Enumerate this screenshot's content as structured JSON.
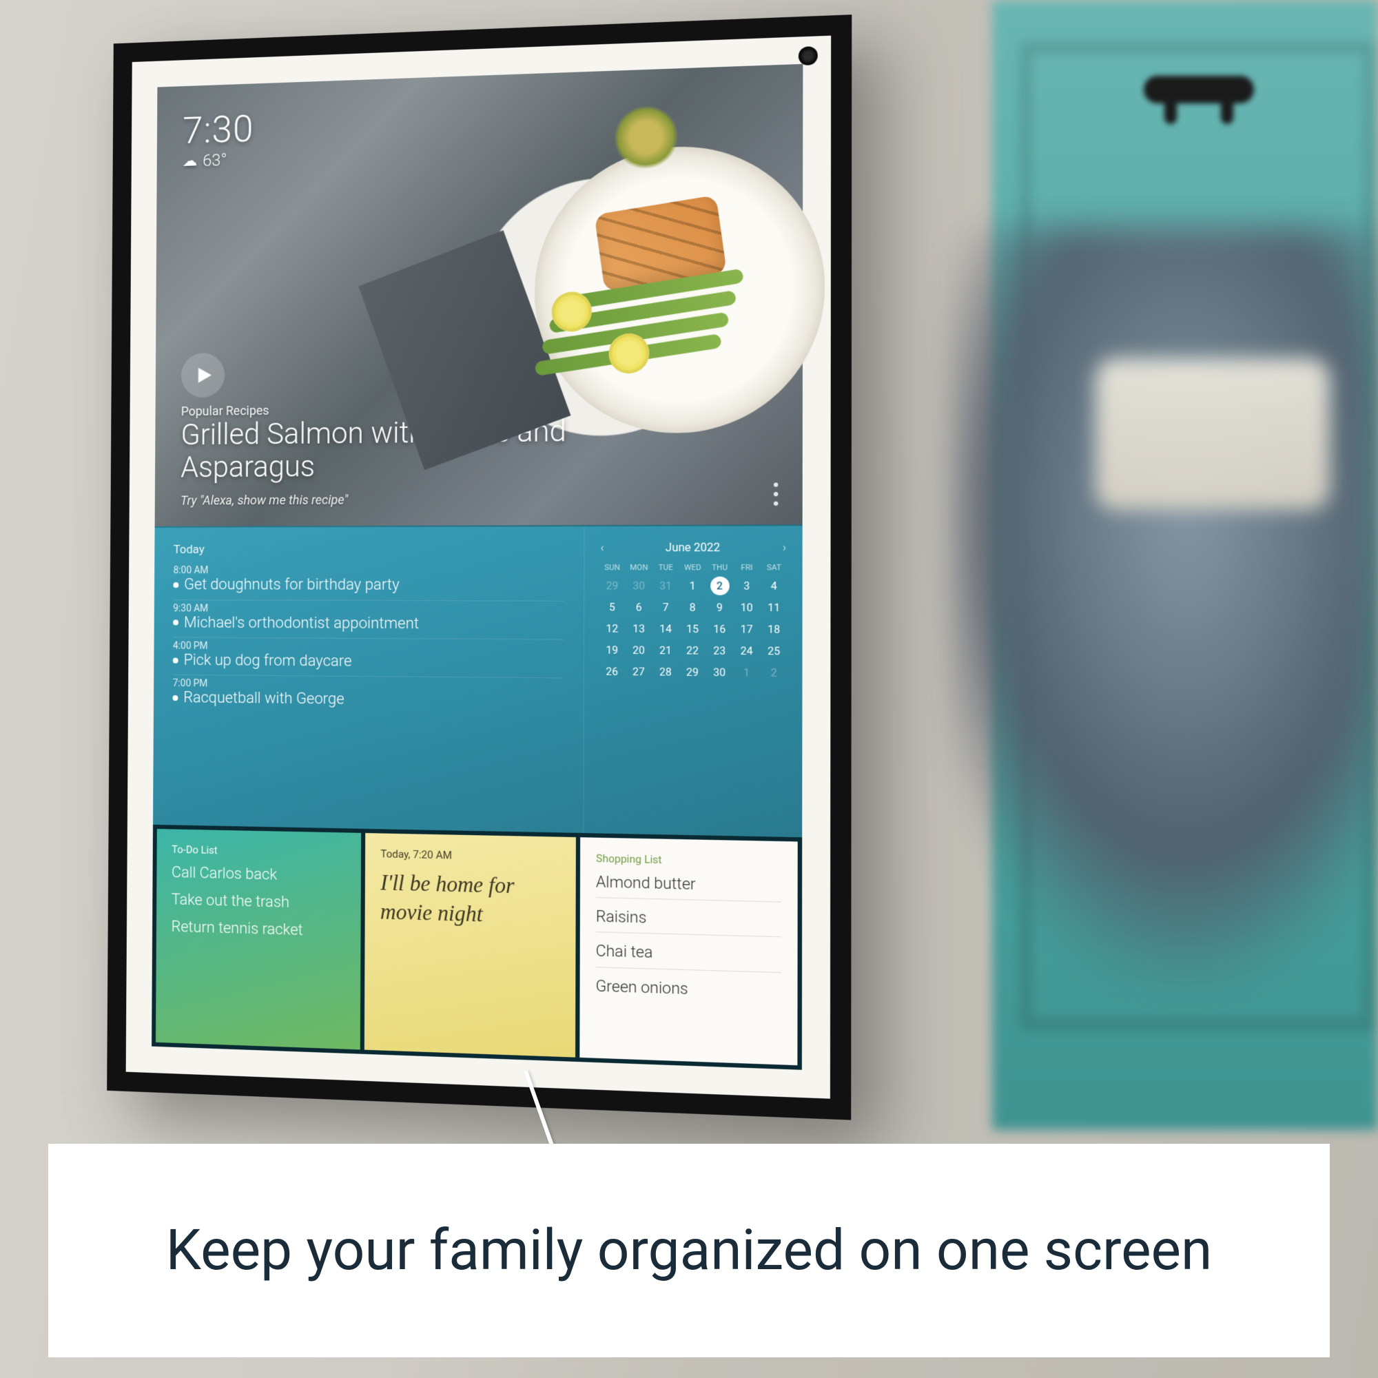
{
  "caption": "Keep your family organized on one screen",
  "hero": {
    "clock": "7:30",
    "temperature": "63°",
    "category": "Popular Recipes",
    "title": "Grilled Salmon with Herbs and Asparagus",
    "prompt": "Try \"Alexa, show me this recipe\""
  },
  "agenda": {
    "header": "Today",
    "items": [
      {
        "time": "8:00 AM",
        "title": "Get doughnuts for birthday party"
      },
      {
        "time": "9:30 AM",
        "title": "Michael's orthodontist appointment"
      },
      {
        "time": "4:00 PM",
        "title": "Pick up dog from daycare"
      },
      {
        "time": "7:00 PM",
        "title": "Racquetball with George"
      }
    ]
  },
  "calendar": {
    "month": "June 2022",
    "dows": [
      "SUN",
      "MON",
      "TUE",
      "WED",
      "THU",
      "FRI",
      "SAT"
    ],
    "leading": [
      29,
      30,
      31
    ],
    "days": [
      1,
      2,
      3,
      4,
      5,
      6,
      7,
      8,
      9,
      10,
      11,
      12,
      13,
      14,
      15,
      16,
      17,
      18,
      19,
      20,
      21,
      22,
      23,
      24,
      25,
      26,
      27,
      28,
      29,
      30
    ],
    "trailing": [
      1,
      2
    ],
    "today": 2
  },
  "todo": {
    "header": "To-Do List",
    "items": [
      "Call Carlos back",
      "Take out the trash",
      "Return tennis racket"
    ]
  },
  "note": {
    "header": "Today, 7:20 AM",
    "text": "I'll be home for movie night"
  },
  "shopping": {
    "header": "Shopping List",
    "items": [
      "Almond butter",
      "Raisins",
      "Chai tea",
      "Green onions"
    ]
  }
}
